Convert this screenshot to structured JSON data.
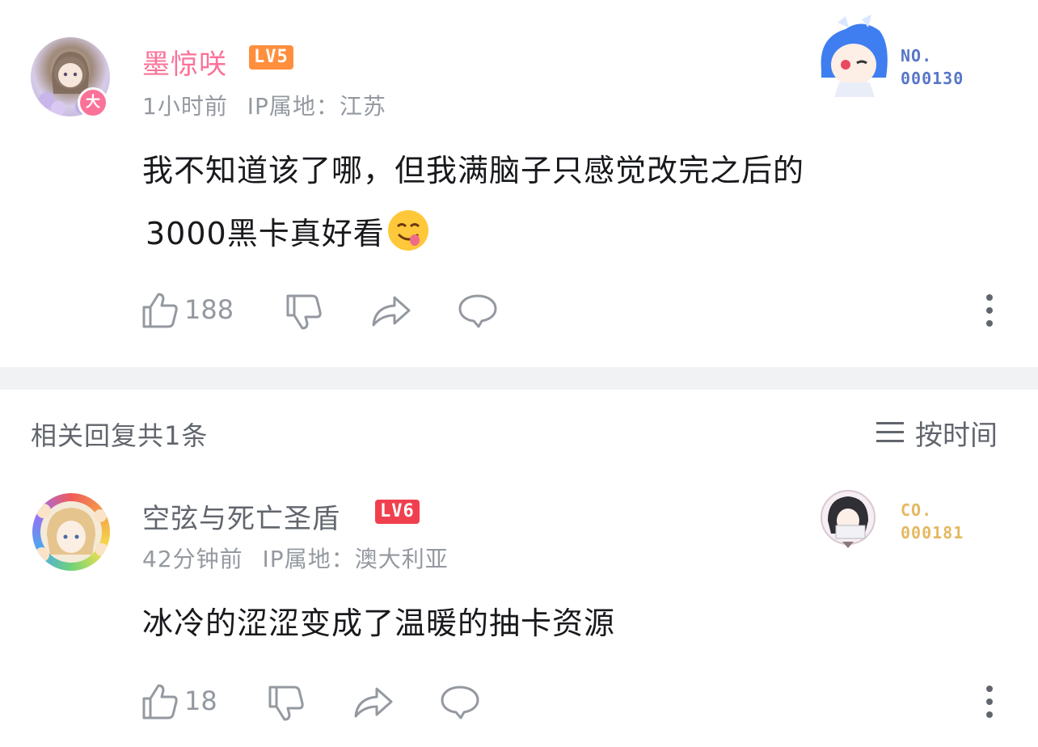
{
  "comment": {
    "username": "墨惊咲",
    "level": "LV5",
    "time": "1小时前",
    "ip": "IP属地：江苏",
    "content_line1": "我不知道该了哪，但我满脑子只感觉改完之后的",
    "content_line2": "3000黑卡真好看",
    "emoji": "😋",
    "avatar_badge": "大",
    "fan_badge_label": "NO.",
    "fan_badge_number": "000130",
    "like_count": "188"
  },
  "replies_header": {
    "title": "相关回复共1条",
    "sort_label": "按时间"
  },
  "reply": {
    "username": "空弦与死亡圣盾",
    "level": "LV6",
    "time": "42分钟前",
    "ip": "IP属地：澳大利亚",
    "content": "冰冷的涩涩变成了温暖的抽卡资源",
    "fan_badge_label": "CO.",
    "fan_badge_number": "000181",
    "like_count": "18"
  },
  "colors": {
    "username_pink": "#fb7299",
    "lv5": "#ff8f3d",
    "lv6": "#f0404f",
    "badge_blue": "#5876c8",
    "badge_gold": "#e5b860",
    "meta_gray": "#9499a0"
  }
}
